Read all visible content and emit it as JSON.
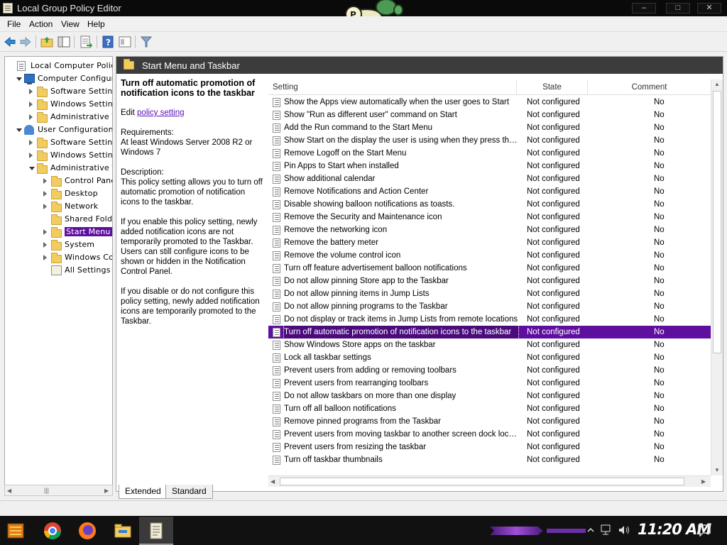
{
  "window": {
    "title": "Local Group Policy Editor",
    "minimize": "–",
    "maximize": "□",
    "close": "✕"
  },
  "menubar": {
    "items": [
      "File",
      "Action",
      "View",
      "Help"
    ]
  },
  "toolbar": {
    "icons": [
      "back-arrow-icon",
      "forward-arrow-icon",
      "up-folder-icon",
      "show-hide-tree-icon",
      "export-list-icon",
      "help-icon",
      "properties-icon",
      "filter-icon"
    ]
  },
  "tree": {
    "items": [
      {
        "label": "Local Computer Policy",
        "icon": "policy-icon",
        "level": 0,
        "expand": "none"
      },
      {
        "label": "Computer Configurati",
        "icon": "computer-icon",
        "level": 1,
        "expand": "down"
      },
      {
        "label": "Software Setting",
        "icon": "folder-icon",
        "level": 2,
        "expand": "right"
      },
      {
        "label": "Windows Setting:",
        "icon": "folder-icon",
        "level": 2,
        "expand": "right"
      },
      {
        "label": "Administrative Te",
        "icon": "folder-icon",
        "level": 2,
        "expand": "right"
      },
      {
        "label": "User Configuration",
        "icon": "user-icon",
        "level": 1,
        "expand": "down"
      },
      {
        "label": "Software Setting",
        "icon": "folder-icon",
        "level": 2,
        "expand": "right"
      },
      {
        "label": "Windows Setting:",
        "icon": "folder-icon",
        "level": 2,
        "expand": "right"
      },
      {
        "label": "Administrative Te",
        "icon": "folder-icon",
        "level": 2,
        "expand": "down"
      },
      {
        "label": "Control Panel",
        "icon": "folder-icon",
        "level": 3,
        "expand": "right"
      },
      {
        "label": "Desktop",
        "icon": "folder-icon",
        "level": 3,
        "expand": "right"
      },
      {
        "label": "Network",
        "icon": "folder-icon",
        "level": 3,
        "expand": "right"
      },
      {
        "label": "Shared Folder",
        "icon": "folder-icon",
        "level": 3,
        "expand": "none"
      },
      {
        "label": "Start Menu a",
        "icon": "folder-icon",
        "level": 3,
        "expand": "right",
        "selected": true
      },
      {
        "label": "System",
        "icon": "folder-icon",
        "level": 3,
        "expand": "right"
      },
      {
        "label": "Windows Com",
        "icon": "folder-icon",
        "level": 3,
        "expand": "right"
      },
      {
        "label": "All Settings",
        "icon": "settings-icon",
        "level": 3,
        "expand": "none"
      }
    ]
  },
  "pane": {
    "header_title": "Start Menu and Taskbar",
    "policy_title": "Turn off automatic promotion of notification icons to the taskbar",
    "edit_prefix": "Edit",
    "edit_link": "policy setting",
    "requirements": "Requirements:\nAt least Windows Server 2008 R2 or Windows 7",
    "description_label": "Description:",
    "description": "This policy setting allows you to turn off automatic promotion of notification icons to the taskbar.",
    "enable_text": "If you enable this policy setting, newly added notification icons are not temporarily promoted to the Taskbar. Users can still configure icons to be shown or hidden in the Notification Control Panel.",
    "disable_text": "If you disable or do not configure this policy setting, newly added notification icons are temporarily promoted to the Taskbar."
  },
  "list": {
    "columns": {
      "setting": "Setting",
      "state": "State",
      "comment": "Comment"
    },
    "rows": [
      {
        "name": "Show the Apps view automatically when the user goes to Start",
        "state": "Not configured",
        "comment": "No"
      },
      {
        "name": "Show \"Run as different user\" command on Start",
        "state": "Not configured",
        "comment": "No"
      },
      {
        "name": "Add the Run command to the Start Menu",
        "state": "Not configured",
        "comment": "No"
      },
      {
        "name": "Show Start on the display the user is using when they press the Wi...",
        "state": "Not configured",
        "comment": "No"
      },
      {
        "name": "Remove Logoff on the Start Menu",
        "state": "Not configured",
        "comment": "No"
      },
      {
        "name": "Pin Apps to Start when installed",
        "state": "Not configured",
        "comment": "No"
      },
      {
        "name": "Show additional calendar",
        "state": "Not configured",
        "comment": "No"
      },
      {
        "name": "Remove Notifications and Action Center",
        "state": "Not configured",
        "comment": "No"
      },
      {
        "name": "Disable showing balloon notifications as toasts.",
        "state": "Not configured",
        "comment": "No"
      },
      {
        "name": "Remove the Security and Maintenance icon",
        "state": "Not configured",
        "comment": "No"
      },
      {
        "name": "Remove the networking icon",
        "state": "Not configured",
        "comment": "No"
      },
      {
        "name": "Remove the battery meter",
        "state": "Not configured",
        "comment": "No"
      },
      {
        "name": "Remove the volume control icon",
        "state": "Not configured",
        "comment": "No"
      },
      {
        "name": "Turn off feature advertisement balloon notifications",
        "state": "Not configured",
        "comment": "No"
      },
      {
        "name": "Do not allow pinning Store app to the Taskbar",
        "state": "Not configured",
        "comment": "No"
      },
      {
        "name": "Do not allow pinning items in Jump Lists",
        "state": "Not configured",
        "comment": "No"
      },
      {
        "name": "Do not allow pinning programs to the Taskbar",
        "state": "Not configured",
        "comment": "No"
      },
      {
        "name": "Do not display or track items in Jump Lists from remote locations",
        "state": "Not configured",
        "comment": "No"
      },
      {
        "name": "Turn off automatic promotion of notification icons to the taskbar",
        "state": "Not configured",
        "comment": "No",
        "selected": true
      },
      {
        "name": "Show Windows Store apps on the taskbar",
        "state": "Not configured",
        "comment": "No"
      },
      {
        "name": "Lock all taskbar settings",
        "state": "Not configured",
        "comment": "No"
      },
      {
        "name": "Prevent users from adding or removing toolbars",
        "state": "Not configured",
        "comment": "No"
      },
      {
        "name": "Prevent users from rearranging toolbars",
        "state": "Not configured",
        "comment": "No"
      },
      {
        "name": "Do not allow taskbars on more than one display",
        "state": "Not configured",
        "comment": "No"
      },
      {
        "name": "Turn off all balloon notifications",
        "state": "Not configured",
        "comment": "No"
      },
      {
        "name": "Remove pinned programs from the Taskbar",
        "state": "Not configured",
        "comment": "No"
      },
      {
        "name": "Prevent users from moving taskbar to another screen dock location",
        "state": "Not configured",
        "comment": "No"
      },
      {
        "name": "Prevent users from resizing the taskbar",
        "state": "Not configured",
        "comment": "No"
      },
      {
        "name": "Turn off taskbar thumbnails",
        "state": "Not configured",
        "comment": "No"
      }
    ]
  },
  "tabs": {
    "extended": "Extended",
    "standard": "Standard"
  },
  "taskbar": {
    "clock": "11:20 AM",
    "items": [
      "start-icon",
      "chrome-icon",
      "firefox-icon",
      "file-explorer-icon",
      "group-policy-icon"
    ]
  },
  "colors": {
    "selection": "#5f0f9e",
    "header_bg": "#3c3c3c"
  }
}
